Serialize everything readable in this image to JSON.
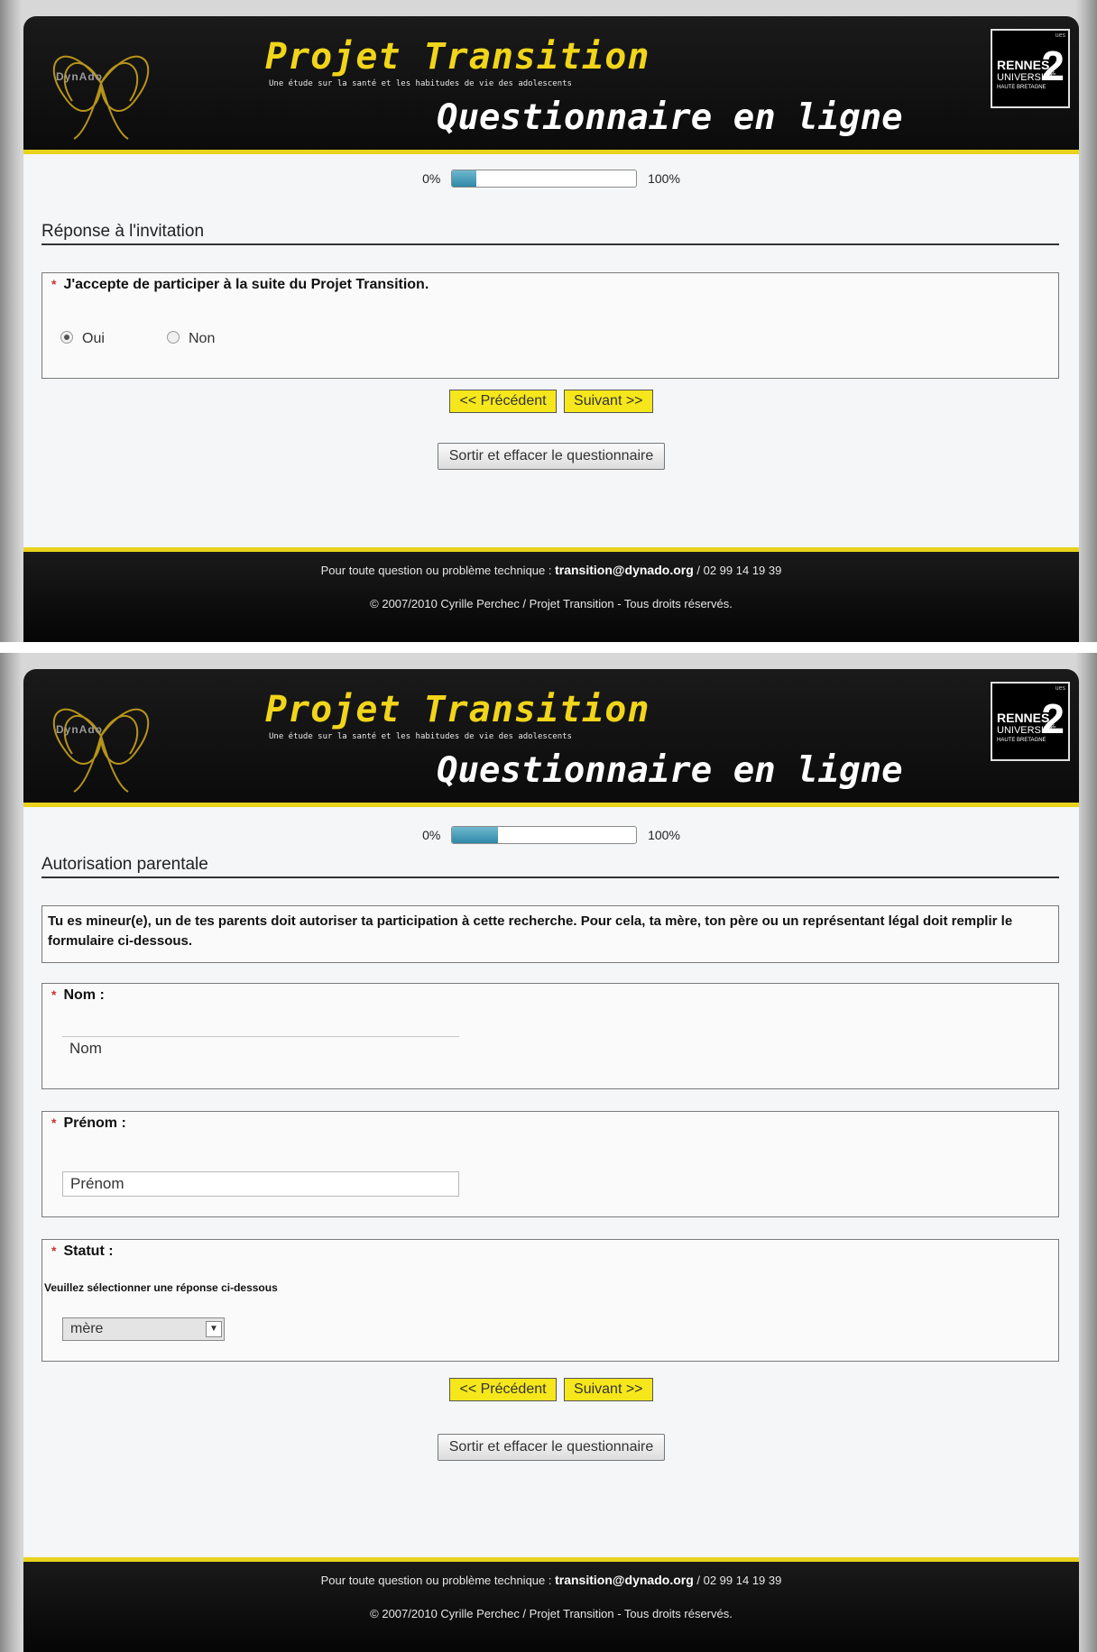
{
  "header": {
    "dynado_logo": "DynAdo",
    "title": "Projet Transition",
    "subtitle": "Une étude sur la santé et les habitudes de vie des adolescents",
    "questionnaire": "Questionnaire en ligne",
    "rennes_name": "RENNES",
    "rennes_univ": "UNIVERSITÉ",
    "rennes_region": "HAUTE BRETAGNE",
    "rennes_number": "2",
    "rennes_tiny": "ues"
  },
  "progress": {
    "start_label": "0%",
    "end_label": "100%"
  },
  "screen1": {
    "progress_fraction": 0.13,
    "section_title": "Réponse à l'invitation",
    "question": "J'accepte de participer à la suite du Projet Transition.",
    "required_mark": "*",
    "options": [
      {
        "label": "Oui",
        "selected": true
      },
      {
        "label": "Non",
        "selected": false
      }
    ]
  },
  "screen2": {
    "progress_fraction": 0.25,
    "section_title": "Autorisation parentale",
    "intro": "Tu es mineur(e), un de tes parents doit autoriser ta participation à cette recherche. Pour cela, ta mère, ton père ou un représentant légal doit remplir le formulaire ci-dessous.",
    "required_mark": "*",
    "nom_label": "Nom :",
    "nom_value": "Nom",
    "prenom_label": "Prénom :",
    "prenom_value": "Prénom",
    "statut_label": "Statut :",
    "statut_helper": "Veuillez sélectionner une réponse ci-dessous",
    "statut_value": "mère"
  },
  "buttons": {
    "previous": "<< Précédent",
    "next": "Suivant >>",
    "exit": "Sortir et effacer le questionnaire"
  },
  "footer": {
    "contact_prefix": "Pour toute question ou problème technique :",
    "email": "transition@dynado.org",
    "phone": " / 02 99 14 19 39",
    "copyright": "© 2007/2010 Cyrille Perchec / Projet Transition - Tous droits réservés."
  },
  "colors": {
    "accent_yellow": "#e8d21c",
    "header_bg": "#0b0b0b",
    "progress_fill": "#2f88a8",
    "button_yellow": "#f6e71c"
  }
}
